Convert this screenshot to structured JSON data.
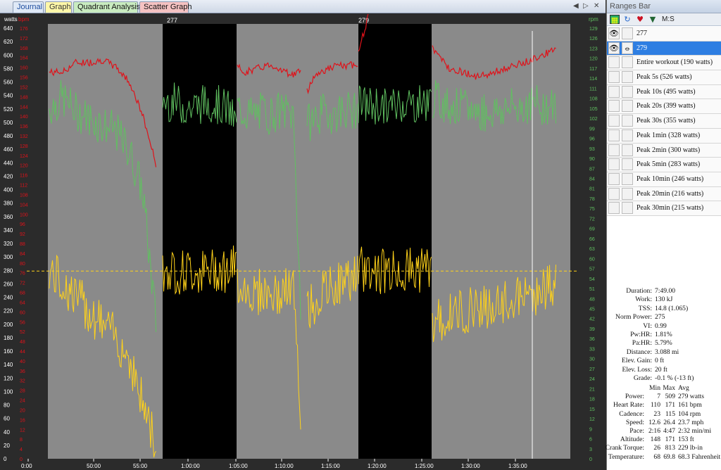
{
  "tabs": [
    {
      "label": "Journal"
    },
    {
      "label": "Graph"
    },
    {
      "label": "Quadrant Analysis"
    },
    {
      "label": "Scatter Graph"
    }
  ],
  "tab_controls": [
    "◀",
    "▷",
    "✕"
  ],
  "ranges_bar": {
    "title": "Ranges Bar",
    "toolbar": {
      "icons": [
        "chart-icon",
        "refresh-icon",
        "heart-icon",
        "mountain-icon"
      ],
      "ms_label": "M:S"
    },
    "rows": [
      {
        "label": "277",
        "eye": true,
        "lock": false,
        "selected": false
      },
      {
        "label": "279",
        "eye": true,
        "lock": true,
        "selected": true
      },
      {
        "label": "Entire workout (190 watts)"
      },
      {
        "label": "Peak 5s (526 watts)"
      },
      {
        "label": "Peak 10s (495 watts)"
      },
      {
        "label": "Peak 20s (399 watts)"
      },
      {
        "label": "Peak 30s (355 watts)"
      },
      {
        "label": "Peak 1min (328 watts)"
      },
      {
        "label": "Peak 2min (300 watts)"
      },
      {
        "label": "Peak 5min (283 watts)"
      },
      {
        "label": "Peak 10min (246 watts)"
      },
      {
        "label": "Peak 20min (216 watts)"
      },
      {
        "label": "Peak 30min (215 watts)"
      }
    ]
  },
  "stats": [
    {
      "k": "Duration:",
      "v": "7:49.00"
    },
    {
      "k": "Work:",
      "v": "130 kJ"
    },
    {
      "k": "TSS:",
      "v": "14.8 (1.065)"
    },
    {
      "k": "Norm Power:",
      "v": "275"
    },
    {
      "k": "VI:",
      "v": "0.99"
    },
    {
      "k": "Pw:HR:",
      "v": "1.81%"
    },
    {
      "k": "Pa:HR:",
      "v": "5.79%"
    },
    {
      "k": "Distance:",
      "v": "3.088 mi"
    },
    {
      "k": "Elev. Gain:",
      "v": "0 ft"
    },
    {
      "k": "Elev. Loss:",
      "v": "20 ft"
    },
    {
      "k": "Grade:",
      "v": "-0.1 % (-13 ft)"
    }
  ],
  "stats_table": {
    "header": [
      "",
      "Min",
      "Max",
      "Avg"
    ],
    "rows": [
      [
        "Power:",
        "7",
        "509",
        "279 watts"
      ],
      [
        "Heart Rate:",
        "110",
        "171",
        "161 bpm"
      ],
      [
        "Cadence:",
        "23",
        "115",
        "104 rpm"
      ],
      [
        "Speed:",
        "12.6",
        "26.4",
        "23.7 mph"
      ],
      [
        "Pace:",
        "2:16",
        "4:47",
        "2:32 min/mi"
      ],
      [
        "Altitude:",
        "148",
        "171",
        "153 ft"
      ],
      [
        "Crank Torque:",
        "26",
        "813",
        "229 lb-in"
      ],
      [
        "Temperature:",
        "68",
        "69.8",
        "68.3 Fahrenheit"
      ]
    ]
  },
  "chart_data": {
    "type": "line",
    "left_axis_label": "watts",
    "left_axis_label2": "bpm",
    "right_axis_label": "rpm",
    "watts_ticks": [
      0,
      20,
      40,
      60,
      80,
      100,
      120,
      140,
      160,
      180,
      200,
      220,
      240,
      260,
      280,
      300,
      320,
      340,
      360,
      380,
      400,
      420,
      440,
      460,
      480,
      500,
      520,
      540,
      560,
      580,
      600,
      620,
      640
    ],
    "bpm_ticks": [
      0,
      4,
      8,
      12,
      16,
      20,
      24,
      28,
      32,
      36,
      40,
      44,
      48,
      52,
      56,
      60,
      64,
      68,
      72,
      76,
      80,
      84,
      88,
      92,
      96,
      100,
      104,
      108,
      112,
      116,
      120,
      124,
      128,
      132,
      136,
      140,
      144,
      148,
      152,
      156,
      160,
      164,
      168,
      172,
      176
    ],
    "rpm_ticks": [
      0,
      3,
      6,
      9,
      12,
      15,
      18,
      21,
      24,
      27,
      30,
      33,
      36,
      39,
      42,
      45,
      48,
      51,
      54,
      57,
      60,
      63,
      66,
      69,
      72,
      75,
      78,
      81,
      84,
      87,
      90,
      93,
      96,
      99,
      102,
      105,
      108,
      111,
      114,
      117,
      120,
      123,
      126,
      129
    ],
    "x_ticks": [
      "0:00",
      "50:00",
      "55:00",
      "1:00:00",
      "1:05:00",
      "1:10:00",
      "1:15:00",
      "1:20:00",
      "1:25:00",
      "1:30:00",
      "1:35:00"
    ],
    "range_labels": [
      "277",
      "279"
    ],
    "avg_power_line": 279,
    "colors": {
      "power": "#ffd21a",
      "heart_rate": "#e0121a",
      "cadence": "#60c060",
      "background": "#8a8a8a",
      "selection": "#000000"
    },
    "series": [
      {
        "name": "watts",
        "color": "#ffd21a"
      },
      {
        "name": "bpm",
        "color": "#e0121a"
      },
      {
        "name": "rpm",
        "color": "#60c060"
      }
    ]
  }
}
